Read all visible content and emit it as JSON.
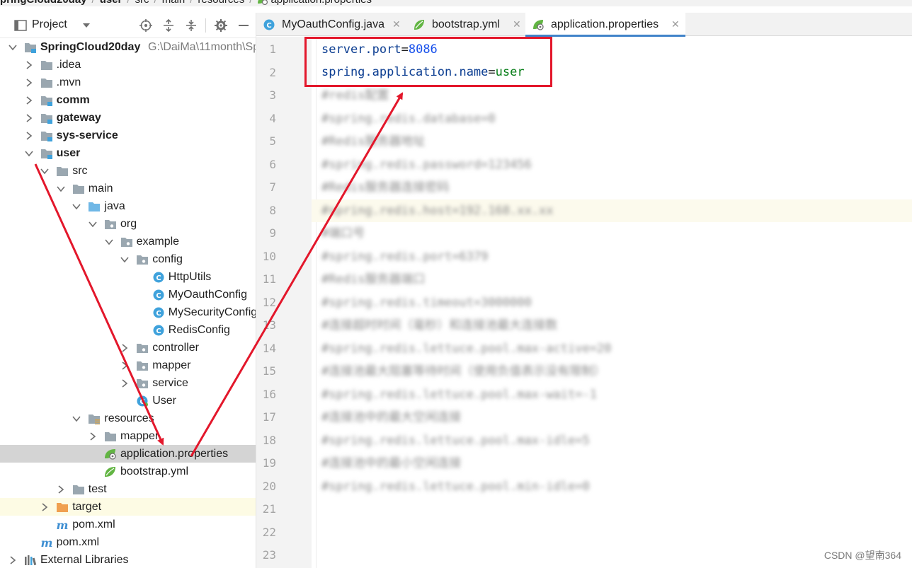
{
  "breadcrumb": {
    "items": [
      "pringCloud20day",
      "user",
      "src",
      "main",
      "resources",
      "application.properties"
    ]
  },
  "project_panel": {
    "title": "Project",
    "tree": [
      {
        "label": "SpringCloud20day",
        "hint": "G:\\DaiMa\\11month\\Sp",
        "bold": true
      },
      {
        "label": ".idea"
      },
      {
        "label": ".mvn"
      },
      {
        "label": "comm",
        "bold": true
      },
      {
        "label": "gateway",
        "bold": true
      },
      {
        "label": "sys-service",
        "bold": true
      },
      {
        "label": "user",
        "bold": true
      },
      {
        "label": "src"
      },
      {
        "label": "main"
      },
      {
        "label": "java"
      },
      {
        "label": "org"
      },
      {
        "label": "example"
      },
      {
        "label": "config"
      },
      {
        "label": "HttpUtils"
      },
      {
        "label": "MyOauthConfig"
      },
      {
        "label": "MySecurityConfig"
      },
      {
        "label": "RedisConfig"
      },
      {
        "label": "controller"
      },
      {
        "label": "mapper"
      },
      {
        "label": "service"
      },
      {
        "label": "User"
      },
      {
        "label": "resources"
      },
      {
        "label": "mapper"
      },
      {
        "label": "application.properties"
      },
      {
        "label": "bootstrap.yml"
      },
      {
        "label": "test"
      },
      {
        "label": "target"
      },
      {
        "label": "pom.xml"
      },
      {
        "label": "pom.xml"
      },
      {
        "label": "External Libraries"
      }
    ]
  },
  "tabs": [
    {
      "label": "MyOauthConfig.java",
      "icon": "java-class-icon"
    },
    {
      "label": "bootstrap.yml",
      "icon": "spring-leaf-icon"
    },
    {
      "label": "application.properties",
      "icon": "spring-properties-icon",
      "active": true
    }
  ],
  "editor": {
    "line_numbers": [
      "1",
      "2",
      "3",
      "4",
      "5",
      "6",
      "7",
      "8",
      "9",
      "10",
      "11",
      "12",
      "13",
      "14",
      "15",
      "16",
      "17",
      "18",
      "19",
      "20",
      "21",
      "22",
      "23"
    ],
    "line1": {
      "key": "server.port",
      "eq": "=",
      "value": "8086"
    },
    "line2": {
      "key": "spring.application.name",
      "eq": "=",
      "value": "user"
    },
    "blurred_lines": [
      "#redis配置",
      "#spring.redis.database=0",
      "#Redis服务器地址",
      "#spring.redis.password=123456",
      "#Redis服务器连接密码",
      "#spring.redis.host=192.168.xx.xx",
      "#端口号",
      "#spring.redis.port=6379",
      "#Redis服务器端口",
      "#spring.redis.timeout=3000000",
      "#连接超时时间（毫秒）和连接池最大连接数",
      "#spring.redis.lettuce.pool.max-active=20",
      "#连接池最大阻塞等待时间（使用负值表示没有限制）",
      "#spring.redis.lettuce.pool.max-wait=-1",
      "#连接池中的最大空闲连接",
      "#spring.redis.lettuce.pool.max-idle=5",
      "#连接池中的最小空闲连接",
      "#spring.redis.lettuce.pool.min-idle=0"
    ]
  },
  "watermark": "CSDN @望南364",
  "colors": {
    "annotation": "#e3172b",
    "tab_underline": "#4083c9",
    "selection": "#d4d4d4"
  }
}
